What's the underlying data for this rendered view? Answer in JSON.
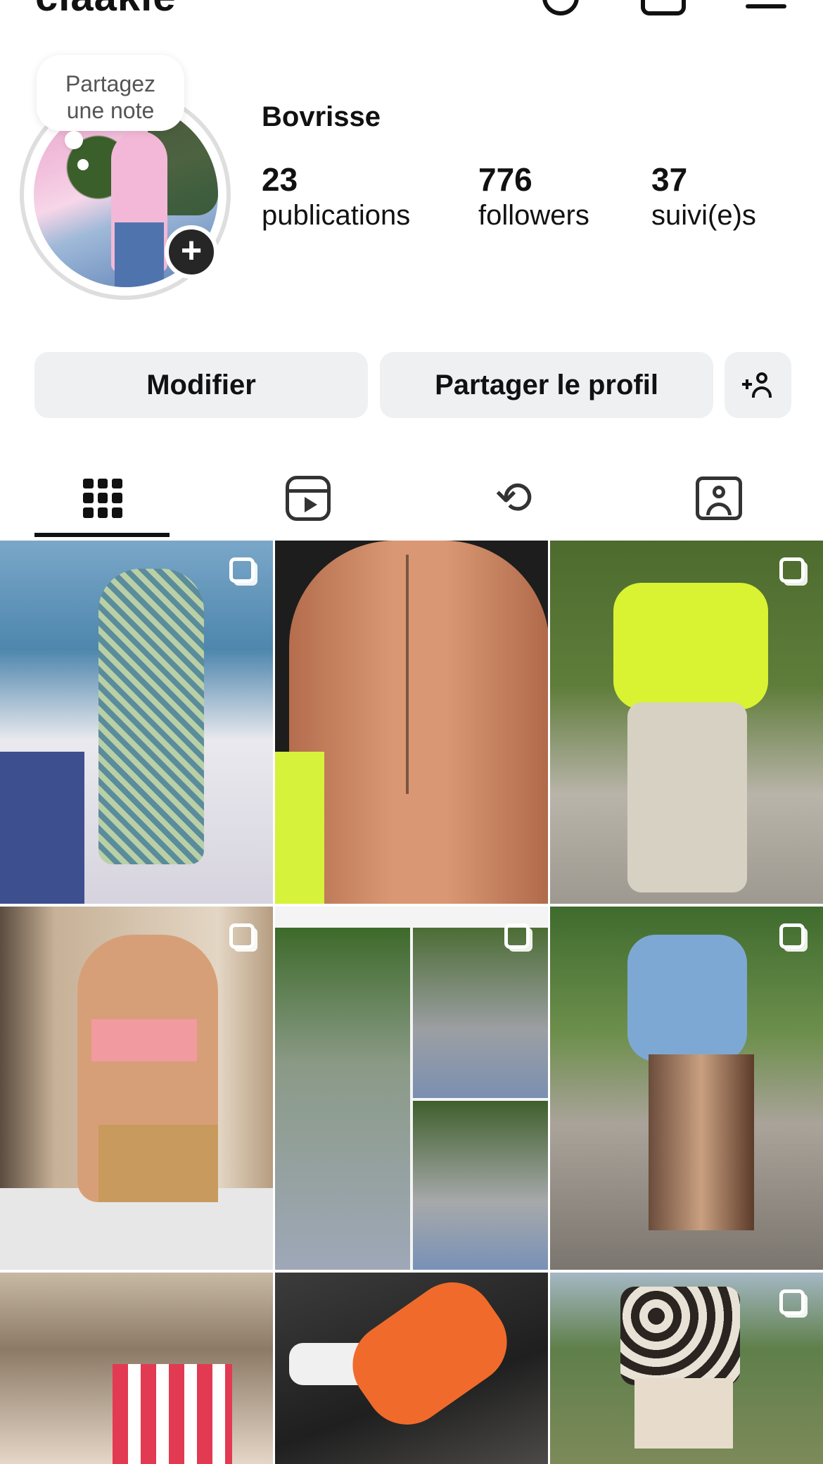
{
  "header": {
    "username": "claakie"
  },
  "profile": {
    "note_line1": "Partagez",
    "note_line2": "une note",
    "display_name": "Bovrisse",
    "stats": {
      "posts_count": "23",
      "posts_label": "publications",
      "followers_count": "776",
      "followers_label": "followers",
      "following_count": "37",
      "following_label": "suivi(e)s"
    }
  },
  "actions": {
    "edit_label": "Modifier",
    "share_label": "Partager le profil"
  },
  "tabs": [
    {
      "icon": "grid-icon",
      "active": true
    },
    {
      "icon": "reels-icon",
      "active": false
    },
    {
      "icon": "repost-icon",
      "active": false
    },
    {
      "icon": "tagged-icon",
      "active": false
    }
  ],
  "grid": {
    "columns": 3,
    "posts": [
      {
        "multi": true
      },
      {
        "multi": false
      },
      {
        "multi": true
      },
      {
        "multi": true
      },
      {
        "multi": true
      },
      {
        "multi": true
      },
      {
        "multi": false
      },
      {
        "multi": false
      },
      {
        "multi": true
      }
    ]
  },
  "colors": {
    "button_bg": "#eef0f2",
    "text": "#111111",
    "accent_dark": "#262626"
  }
}
